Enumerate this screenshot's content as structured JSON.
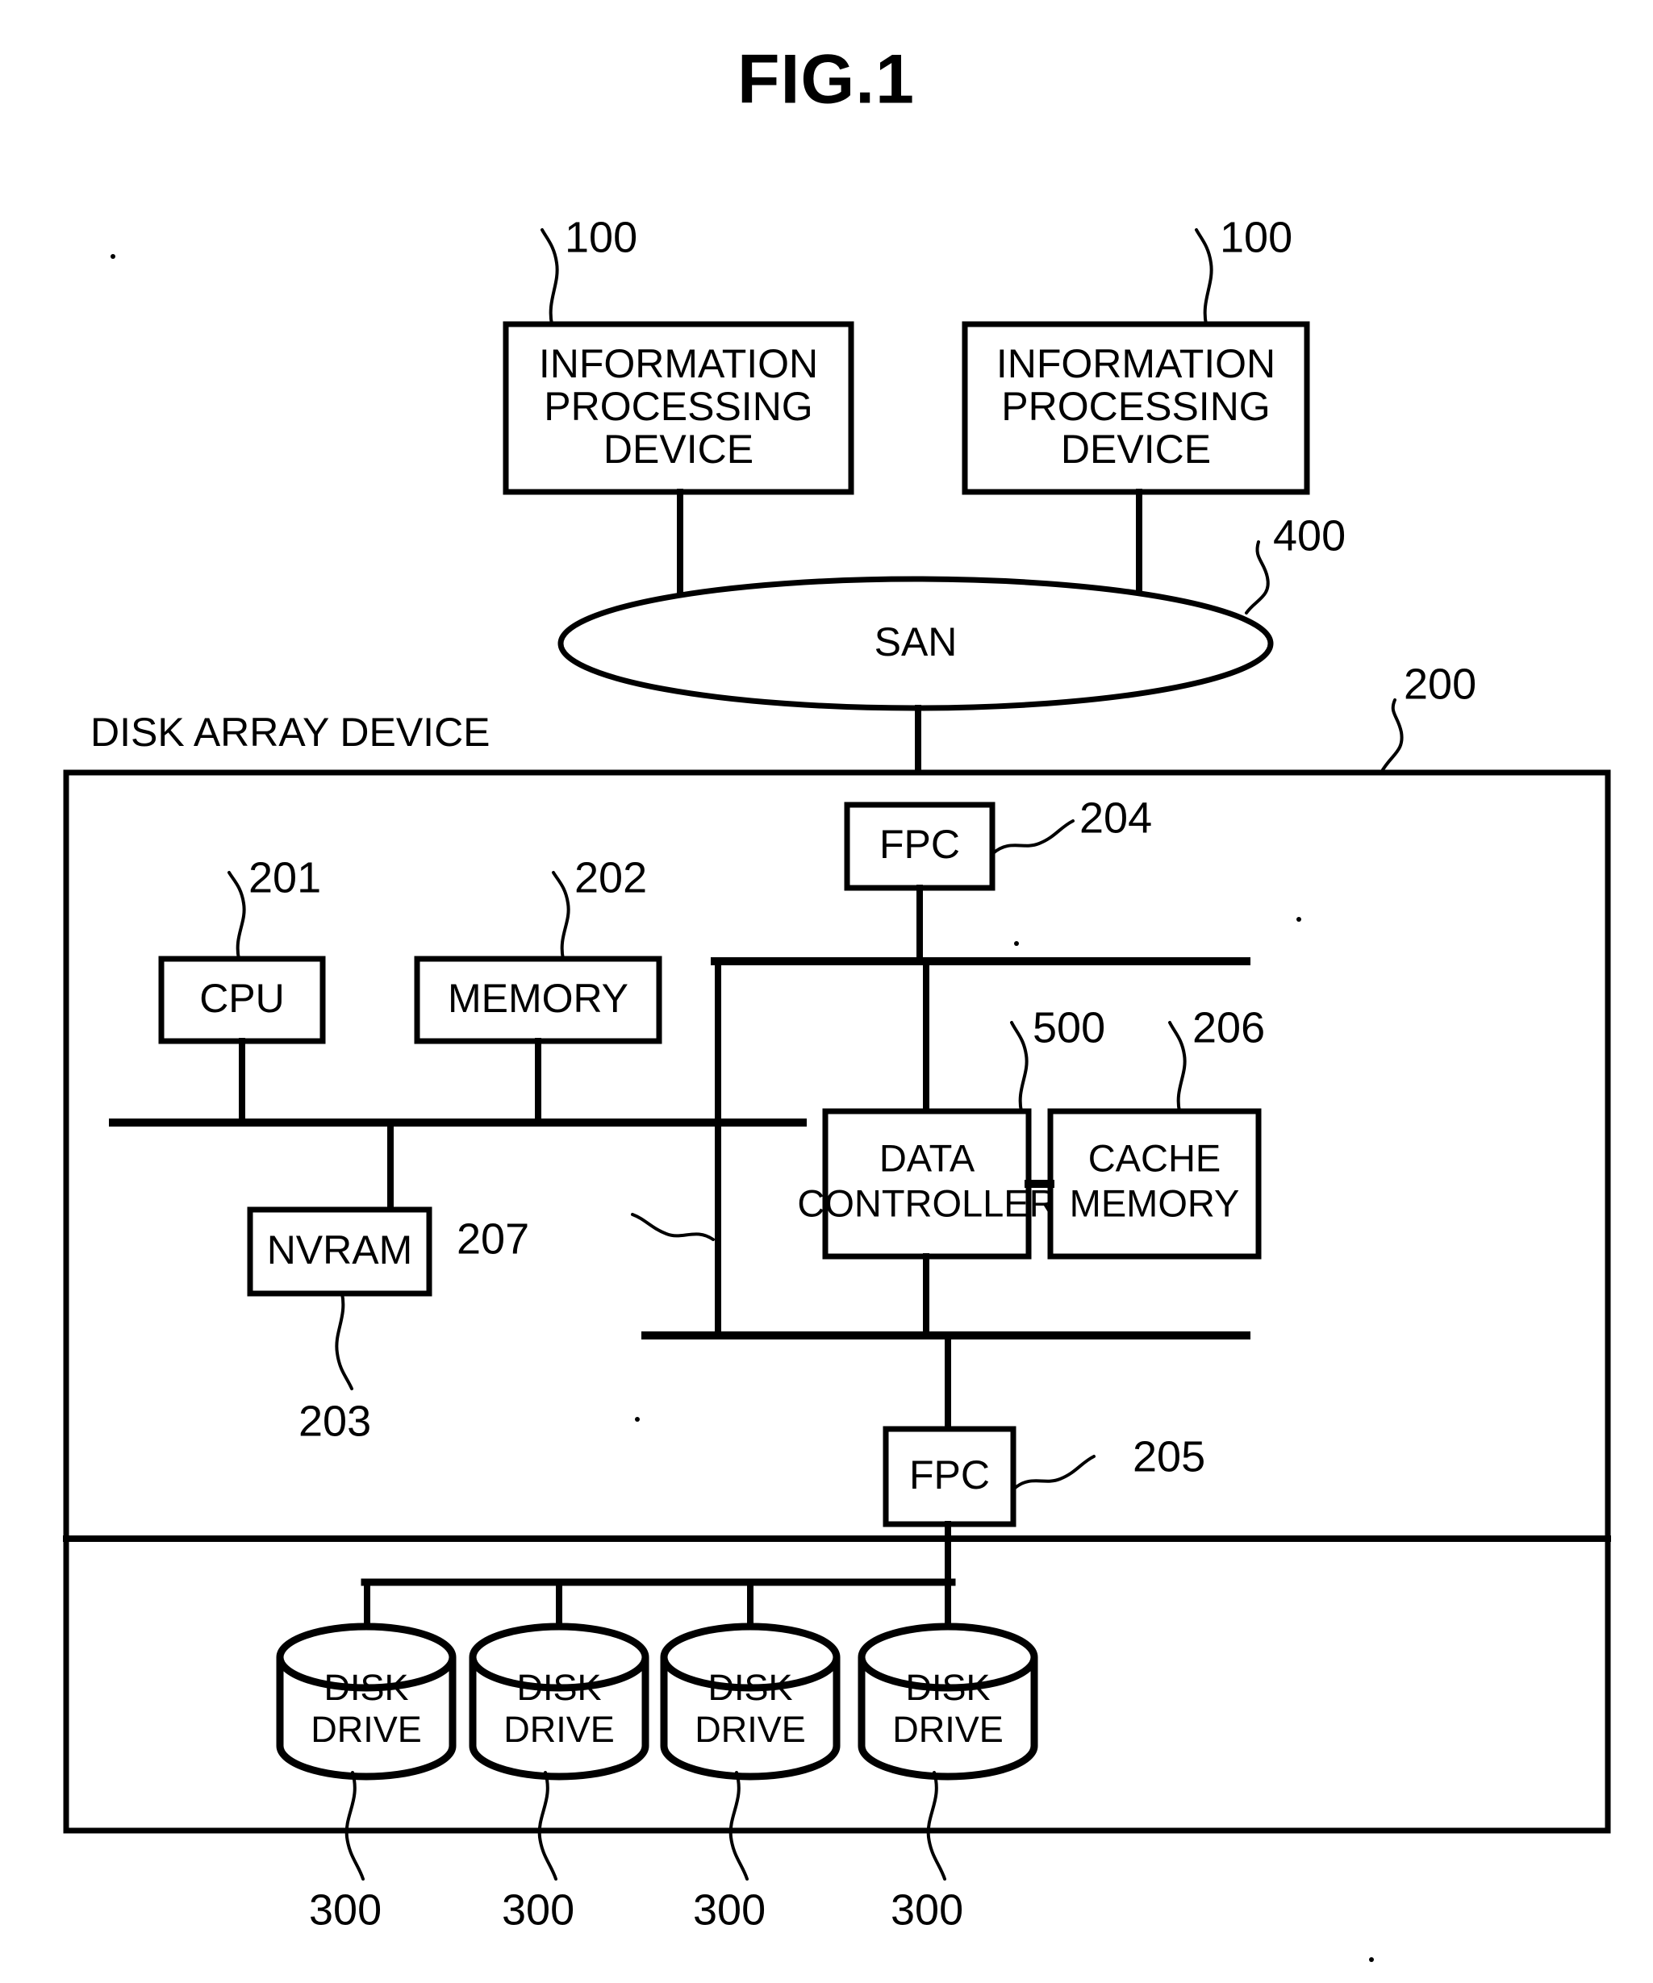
{
  "figure": {
    "title": "FIG.1",
    "section_label": "DISK ARRAY DEVICE"
  },
  "hosts": [
    {
      "label_line1": "INFORMATION",
      "label_line2": "PROCESSING",
      "label_line3": "DEVICE",
      "ref": "100"
    },
    {
      "label_line1": "INFORMATION",
      "label_line2": "PROCESSING",
      "label_line3": "DEVICE",
      "ref": "100"
    }
  ],
  "network": {
    "label": "SAN",
    "ref": "400"
  },
  "disk_array": {
    "ref": "200",
    "components": [
      {
        "name": "front-port-controller-upper",
        "label": "FPC",
        "ref": "204"
      },
      {
        "name": "cpu",
        "label": "CPU",
        "ref": "201"
      },
      {
        "name": "memory",
        "label": "MEMORY",
        "ref": "202"
      },
      {
        "name": "nvram",
        "label": "NVRAM",
        "ref": "203"
      },
      {
        "name": "internal-bus",
        "label": "",
        "ref": "207"
      },
      {
        "name": "data-controller",
        "label_line1": "DATA",
        "label_line2": "CONTROLLER",
        "ref": "500"
      },
      {
        "name": "cache-memory",
        "label_line1": "CACHE",
        "label_line2": "MEMORY",
        "ref": "206"
      },
      {
        "name": "front-port-controller-lower",
        "label": "FPC",
        "ref": "205"
      }
    ]
  },
  "disk_drives": [
    {
      "label_line1": "DISK",
      "label_line2": "DRIVE",
      "ref": "300"
    },
    {
      "label_line1": "DISK",
      "label_line2": "DRIVE",
      "ref": "300"
    },
    {
      "label_line1": "DISK",
      "label_line2": "DRIVE",
      "ref": "300"
    },
    {
      "label_line1": "DISK",
      "label_line2": "DRIVE",
      "ref": "300"
    }
  ],
  "colors": {
    "ink": "#000000",
    "paper": "#ffffff"
  }
}
